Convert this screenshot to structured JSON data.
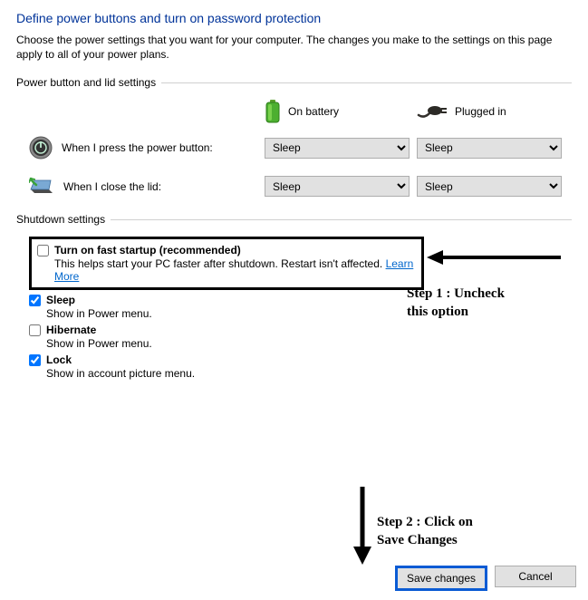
{
  "title": "Define power buttons and turn on password protection",
  "description": "Choose the power settings that you want for your computer. The changes you make to the settings on this page apply to all of your power plans.",
  "sections": {
    "power_lid_header": "Power button and lid settings",
    "shutdown_header": "Shutdown settings"
  },
  "columns": {
    "battery": "On battery",
    "plugged": "Plugged in"
  },
  "rows": {
    "power_button": {
      "label": "When I press the power button:",
      "battery_value": "Sleep",
      "plugged_value": "Sleep"
    },
    "close_lid": {
      "label": "When I close the lid:",
      "battery_value": "Sleep",
      "plugged_value": "Sleep"
    }
  },
  "shutdown": {
    "fast_startup": {
      "label": "Turn on fast startup (recommended)",
      "sub": "This helps start your PC faster after shutdown. Restart isn't affected. ",
      "learn_more": "Learn More",
      "checked": false
    },
    "sleep": {
      "label": "Sleep",
      "sub": "Show in Power menu.",
      "checked": true
    },
    "hibernate": {
      "label": "Hibernate",
      "sub": "Show in Power menu.",
      "checked": false
    },
    "lock": {
      "label": "Lock",
      "sub": "Show in account picture menu.",
      "checked": true
    }
  },
  "buttons": {
    "save": "Save changes",
    "cancel": "Cancel"
  },
  "annotations": {
    "step1": "Step 1 : Uncheck this option",
    "step2": "Step 2 : Click on Save Changes"
  },
  "select_options": [
    "Sleep"
  ]
}
